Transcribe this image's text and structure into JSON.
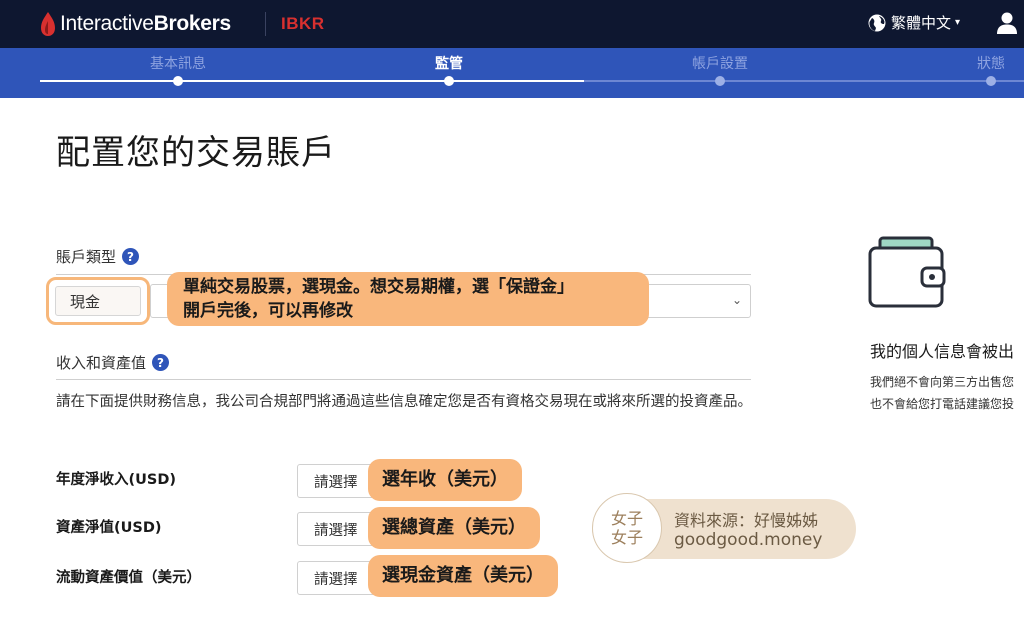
{
  "header": {
    "logo_text_light": "Interactive",
    "logo_text_bold": "Brokers",
    "ticker": "IBKR",
    "language": "繁體中文"
  },
  "stepper": {
    "steps": [
      {
        "label": "基本訊息",
        "state": "done"
      },
      {
        "label": "監管",
        "state": "active"
      },
      {
        "label": "帳戶設置",
        "state": "pending"
      },
      {
        "label": "狀態",
        "state": "pending"
      }
    ]
  },
  "main": {
    "title": "配置您的交易賬戶",
    "account_type": {
      "label": "賬戶類型",
      "help": "?",
      "value": "現金"
    },
    "income": {
      "label": "收入和資產值",
      "help": "?",
      "description": "請在下面提供財務信息，我公司合規部門將通過這些信息確定您是否有資格交易現在或將來所選的投資產品。",
      "fields": [
        {
          "label": "年度淨收入(USD)",
          "value": "請選擇"
        },
        {
          "label": "資產淨值(USD)",
          "value": "請選擇"
        },
        {
          "label": "流動資產價值（美元）",
          "value": "請選擇"
        }
      ]
    }
  },
  "privacy": {
    "title": "我的個人信息會被出",
    "line1": "我們絕不會向第三方出售您",
    "line2": "也不會給您打電話建議您投"
  },
  "annotations": {
    "account_note_line1": "單純交易股票，選現金。想交易期權，選「保證金」",
    "account_note_line2": "開戶完後，可以再修改",
    "field_notes": [
      "選年收（美元）",
      "選總資產（美元）",
      "選現金資產（美元）"
    ]
  },
  "watermark": {
    "seal_line1": "女子",
    "seal_line2": "女子",
    "line1": "資料來源：好慢姊姊",
    "line2": "goodgood.money"
  },
  "colors": {
    "topbar": "#0e1730",
    "stepper": "#2f55b9",
    "brand_red": "#d8302f",
    "annotation": "#f9b77c"
  }
}
